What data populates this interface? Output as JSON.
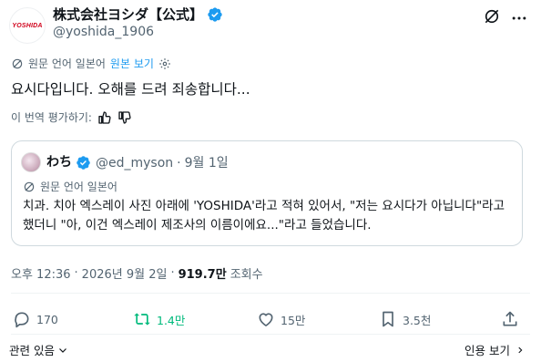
{
  "account": {
    "name": "株式会社ヨシダ【公式】",
    "handle": "@yoshida_1906",
    "logo_text": "YOSHIDA"
  },
  "translation": {
    "source_label": "원문 언어 일본어",
    "show_original": "원본 보기"
  },
  "tweet": {
    "text": "요시다입니다. 오해를 드려 죄송합니다..."
  },
  "rating": {
    "label": "이 번역 평가하기:"
  },
  "quote": {
    "name": "わち",
    "handle": "@ed_myson",
    "separator": "·",
    "date": "9월 1일",
    "translation_label": "원문 언어 일본어",
    "text": "치과. 치아 엑스레이 사진 아래에 'YOSHIDA'라고 적혀 있어서, \"저는 요시다가 아닙니다\"라고 했더니 \"아, 이건 엑스레이 제조사의 이름이에요...\"라고 들었습니다."
  },
  "meta": {
    "time": "오후 12:36",
    "date": "2026년 9월 2일",
    "views": "919.7만",
    "views_label": "조회수"
  },
  "actions": {
    "replies": "170",
    "reposts": "1.4만",
    "likes": "15만",
    "bookmarks": "3.5천"
  },
  "footer": {
    "related": "관련 있음",
    "quotes": "인용 보기"
  },
  "colors": {
    "accent": "#1d9bf0",
    "repost_active": "#00ba7c",
    "muted": "#536471",
    "brand_red": "#d0021b"
  }
}
